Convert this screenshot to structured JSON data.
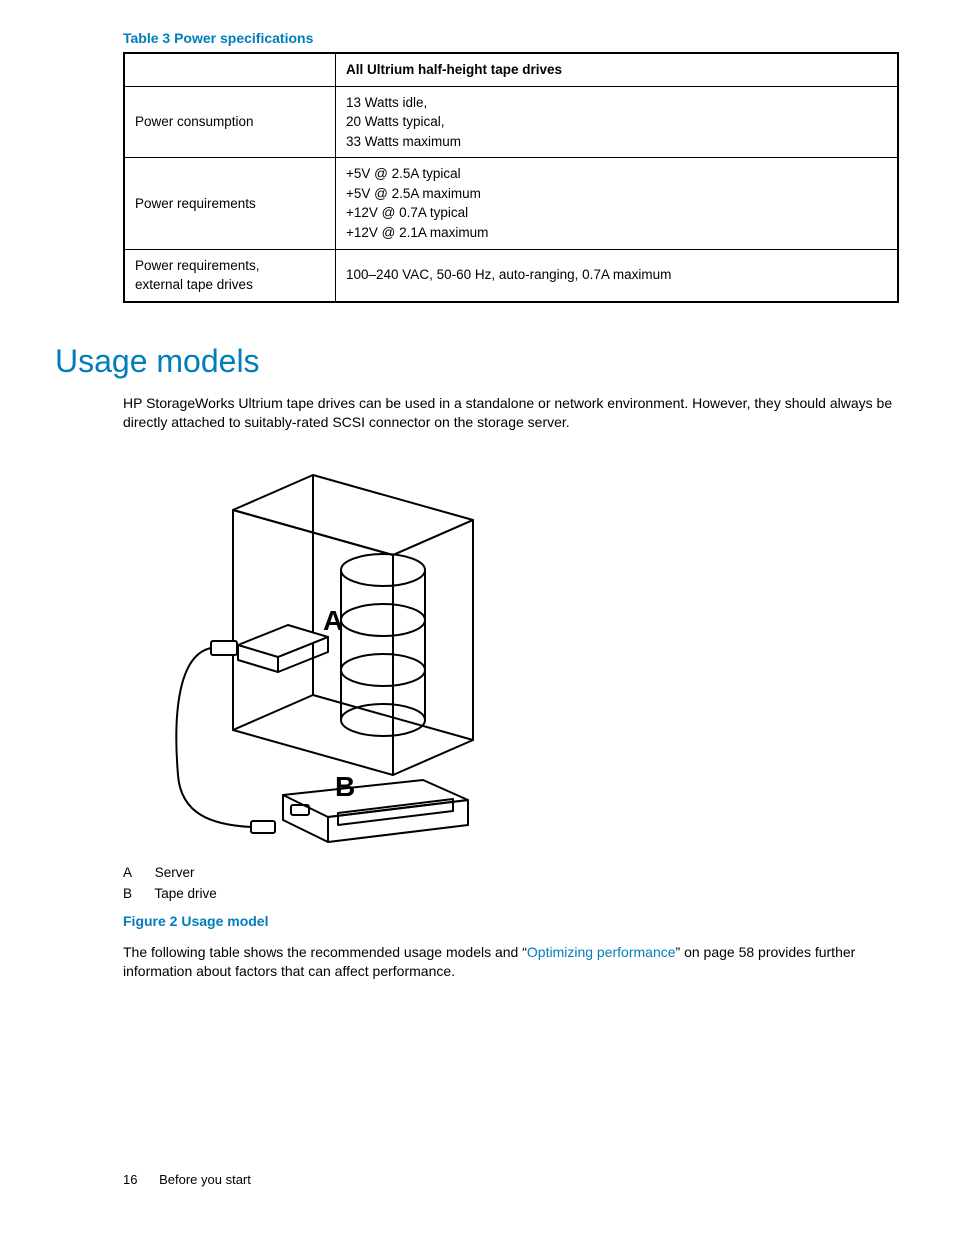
{
  "table3": {
    "caption": "Table 3 Power specifications",
    "header_blank": "",
    "header_col": "All Ultrium half-height tape drives",
    "rows": [
      {
        "label": "Power consumption",
        "value": "13 Watts idle,\n20 Watts typical,\n33 Watts maximum"
      },
      {
        "label": "Power requirements",
        "value": "+5V @ 2.5A typical\n+5V @ 2.5A maximum\n+12V @ 0.7A typical\n+12V @ 2.1A maximum"
      },
      {
        "label": "Power requirements,\nexternal tape drives",
        "value": "100–240 VAC, 50-60 Hz, auto-ranging, 0.7A maximum"
      }
    ]
  },
  "section": {
    "heading": "Usage models",
    "intro": "HP StorageWorks Ultrium tape drives can be used in a standalone or network environment. However, they should always be directly attached to suitably-rated SCSI connector on the storage server."
  },
  "figure2": {
    "label_a": "A",
    "label_b": "B",
    "legend": [
      {
        "letter": "A",
        "text": "Server"
      },
      {
        "letter": "B",
        "text": "Tape drive"
      }
    ],
    "caption": "Figure 2 Usage model"
  },
  "para2": {
    "pre": "The following table shows the recommended usage models and “",
    "link": "Optimizing performance",
    "post": "” on page 58 provides further information about factors that can affect performance."
  },
  "footer": {
    "page": "16",
    "section": "Before you start"
  }
}
